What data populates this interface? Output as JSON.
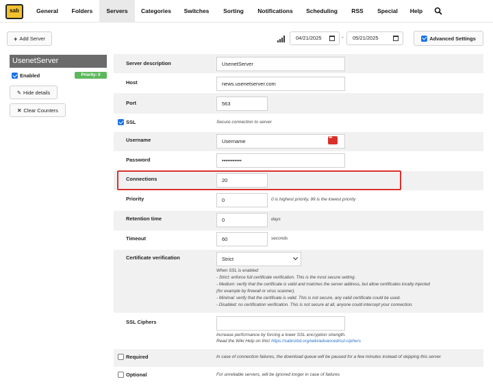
{
  "nav": {
    "logo_text": "sab",
    "items": [
      {
        "label": "General"
      },
      {
        "label": "Folders"
      },
      {
        "label": "Servers"
      },
      {
        "label": "Categories"
      },
      {
        "label": "Switches"
      },
      {
        "label": "Sorting"
      },
      {
        "label": "Notifications"
      },
      {
        "label": "Scheduling"
      },
      {
        "label": "RSS"
      },
      {
        "label": "Special"
      },
      {
        "label": "Help"
      }
    ],
    "active": "Servers"
  },
  "toolbar": {
    "add_server_label": "Add Server",
    "date_from": "04/21/2025",
    "date_sep": "-",
    "date_to": "05/21/2025",
    "advanced_settings_label": "Advanced Settings",
    "advanced_settings_checked": true
  },
  "server": {
    "name": "UsenetServer",
    "enabled_label": "Enabled",
    "enabled": true,
    "priority_badge": "Priority: 0",
    "hide_details_label": "Hide details",
    "clear_counters_label": "Clear Counters"
  },
  "form": {
    "description": {
      "label": "Server description",
      "value": "UsenetServer"
    },
    "host": {
      "label": "Host",
      "value": "news.usenetserver.com"
    },
    "port": {
      "label": "Port",
      "value": "563"
    },
    "ssl": {
      "label": "SSL",
      "checked": true,
      "help": "Secure connection to server"
    },
    "username": {
      "label": "Username",
      "value": "Username"
    },
    "password": {
      "label": "Password",
      "value": "•••••••••••"
    },
    "connections": {
      "label": "Connections",
      "value": "20"
    },
    "priority": {
      "label": "Priority",
      "value": "0",
      "help": "0 is highest priority, 99 is the lowest priority"
    },
    "retention": {
      "label": "Retention time",
      "value": "0",
      "help": "days"
    },
    "timeout": {
      "label": "Timeout",
      "value": "60",
      "help": "seconds"
    },
    "cert": {
      "label": "Certificate verification",
      "value": "Strict",
      "help": [
        "When SSL is enabled:",
        "- Strict: enforce full certificate verification. This is the most secure setting.",
        "- Medium: verify that the certificate is valid and matches the server address, but allow certificates locally injected",
        "(for example by firewall or virus scanner).",
        "- Minimal: verify that the certificate is valid. This is not secure, any valid certificate could be used.",
        "- Disabled: no certification verification. This is not secure at all, anyone could intercept your connection."
      ]
    },
    "ciphers": {
      "label": "SSL Ciphers",
      "value": "",
      "help_line1": "Increase performance by forcing a lower SSL encryption strength.",
      "help_line2": "Read the Wiki Help on this!",
      "help_link": "https://sabnzbd.org/wiki/advanced/ssl-ciphers"
    },
    "required": {
      "label": "Required",
      "checked": false,
      "help": "In case of connection failures, the download queue will be paused for a few minutes instead of skipping this server"
    },
    "optional": {
      "label": "Optional",
      "checked": false,
      "help": "For unreliable servers, will be ignored longer in case of failures"
    }
  },
  "colors": {
    "accent": "#1a73e8",
    "highlight_border": "#d9302c",
    "priority_badge": "#5cb85c",
    "server_header": "#6b6b6b"
  }
}
